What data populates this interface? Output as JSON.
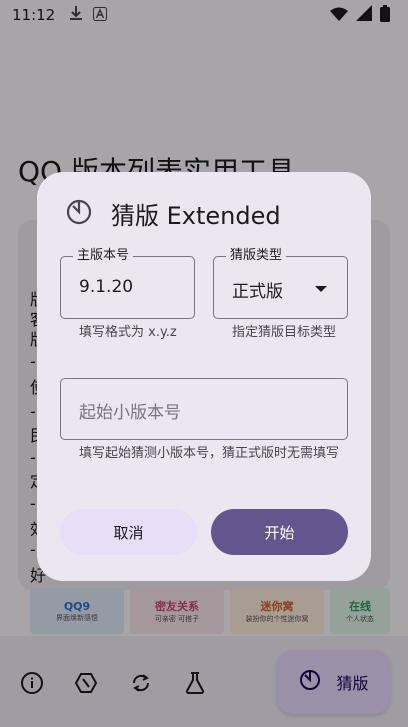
{
  "status_bar": {
    "time": "11:12"
  },
  "background": {
    "title": "QQ 版本列表实用工具",
    "card_lines": [
      "版",
      "客",
      "版",
      "-",
      "使",
      "-",
      "民",
      "-",
      "定",
      "-",
      "效",
      "-",
      "好"
    ],
    "banners": [
      {
        "t1": "QQ9",
        "t2": "界面焕新感悟"
      },
      {
        "t1": "密友关系",
        "t2": "可亲密 可搭子"
      },
      {
        "t1": "迷你窝",
        "t2": "装扮你的个性迷你窝"
      },
      {
        "t1": "在线",
        "t2": "个人状态"
      }
    ]
  },
  "bottom_nav": {
    "fab_label": "猜版"
  },
  "dialog": {
    "title": "猜版 Extended",
    "main_version": {
      "label": "主版本号",
      "value": "9.1.20",
      "helper": "填写格式为 x.y.z"
    },
    "guess_type": {
      "label": "猜版类型",
      "value": "正式版",
      "helper": "指定猜版目标类型"
    },
    "start_minor": {
      "placeholder": "起始小版本号",
      "helper": "填写起始猜测小版本号，猜正式版时无需填写"
    },
    "cancel_label": "取消",
    "start_label": "开始"
  },
  "colors": {
    "primary": "#65558f",
    "dialog_bg": "#ece6f0",
    "fab_bg": "#eaddff",
    "cancel_bg": "#e8def8"
  }
}
